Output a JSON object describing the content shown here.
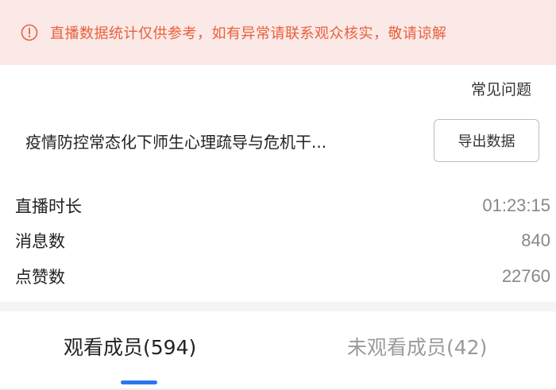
{
  "banner": {
    "icon": "warning-circle-icon",
    "text": "直播数据统计仅供参考，如有异常请联系观众核实，敬请谅解",
    "color": "#e8603c",
    "background": "#fbe9e7"
  },
  "header": {
    "faq_label": "常见问题"
  },
  "course": {
    "title": "疫情防控常态化下师生心理疏导与危机干...",
    "export_label": "导出数据"
  },
  "stats": [
    {
      "label": "直播时长",
      "value": "01:23:15"
    },
    {
      "label": "消息数",
      "value": "840"
    },
    {
      "label": "点赞数",
      "value": "22760"
    }
  ],
  "tabs": [
    {
      "label": "观看成员(594)",
      "active": true
    },
    {
      "label": "未观看成员(42)",
      "active": false
    }
  ],
  "colors": {
    "accent": "#2a78f0",
    "warning": "#e8603c"
  }
}
